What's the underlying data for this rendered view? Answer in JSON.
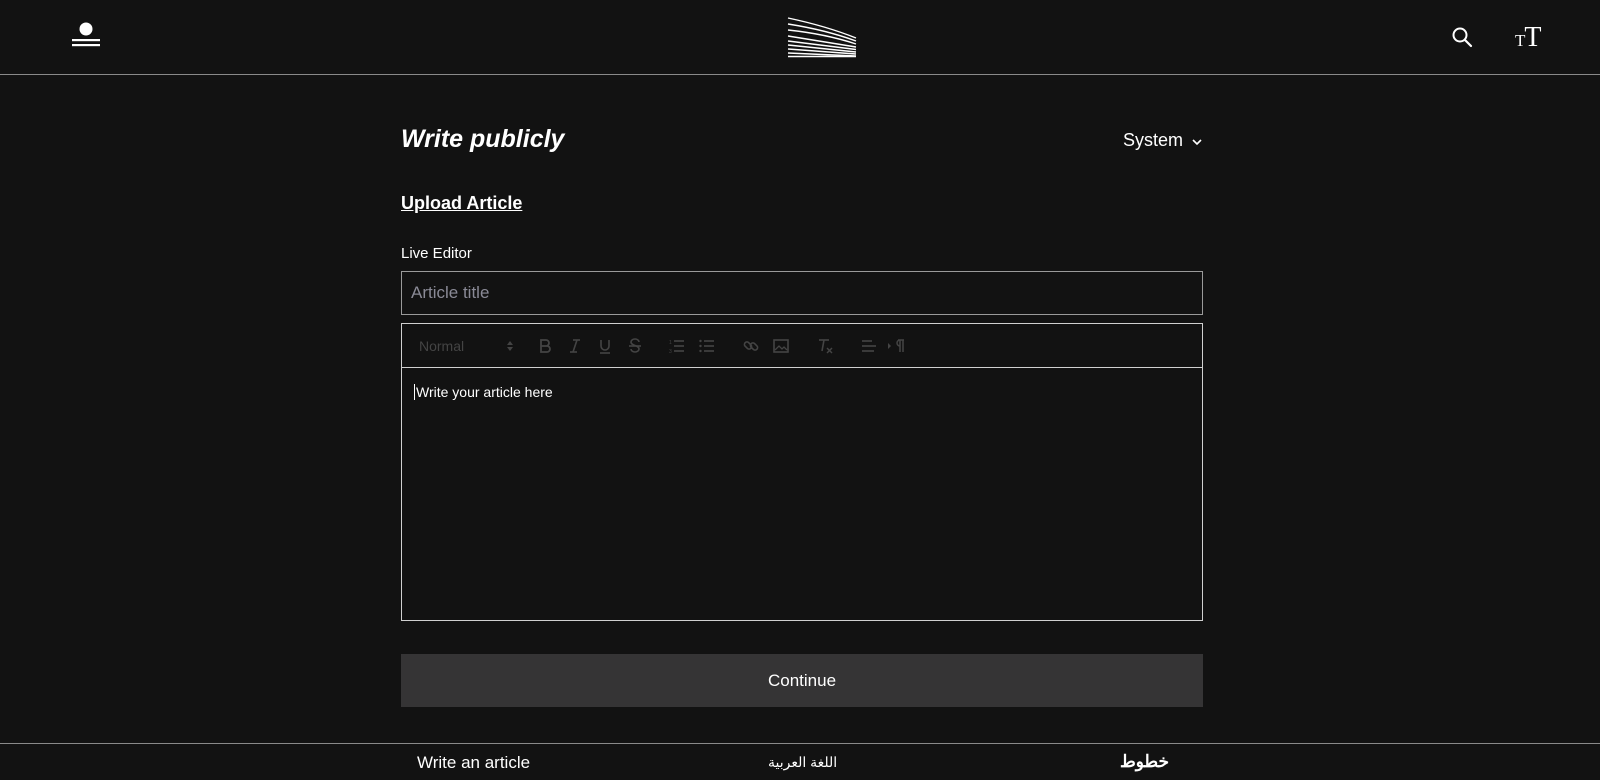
{
  "header": {
    "profile_icon": "user-icon",
    "logo_icon": "publication-logo",
    "search_icon": "search-icon",
    "text_size_icon": "text-size-icon",
    "text_size_small": "T",
    "text_size_big": "T"
  },
  "main": {
    "title": "Write publicly",
    "visibility": {
      "selected": "System",
      "icon": "chevron-down-icon"
    },
    "upload_label": "Upload Article",
    "editor_label": "Live Editor",
    "title_input": {
      "value": "",
      "placeholder": "Article title"
    },
    "toolbar": {
      "format_selected": "Normal",
      "tools": [
        "bold",
        "italic",
        "underline",
        "strikethrough",
        "ordered-list",
        "bullet-list",
        "link",
        "image",
        "clear-format",
        "align",
        "text-direction"
      ]
    },
    "editor_text": "Write your article here",
    "continue_label": "Continue"
  },
  "footer": {
    "write_article": "Write an article",
    "arabic_language": "اللغة العربية",
    "brand": "خطوط"
  },
  "colors": {
    "background": "#121212",
    "text": "#ffffff",
    "button": "#353435",
    "toolbar_icon": "#444444",
    "placeholder": "#8a8a96"
  }
}
